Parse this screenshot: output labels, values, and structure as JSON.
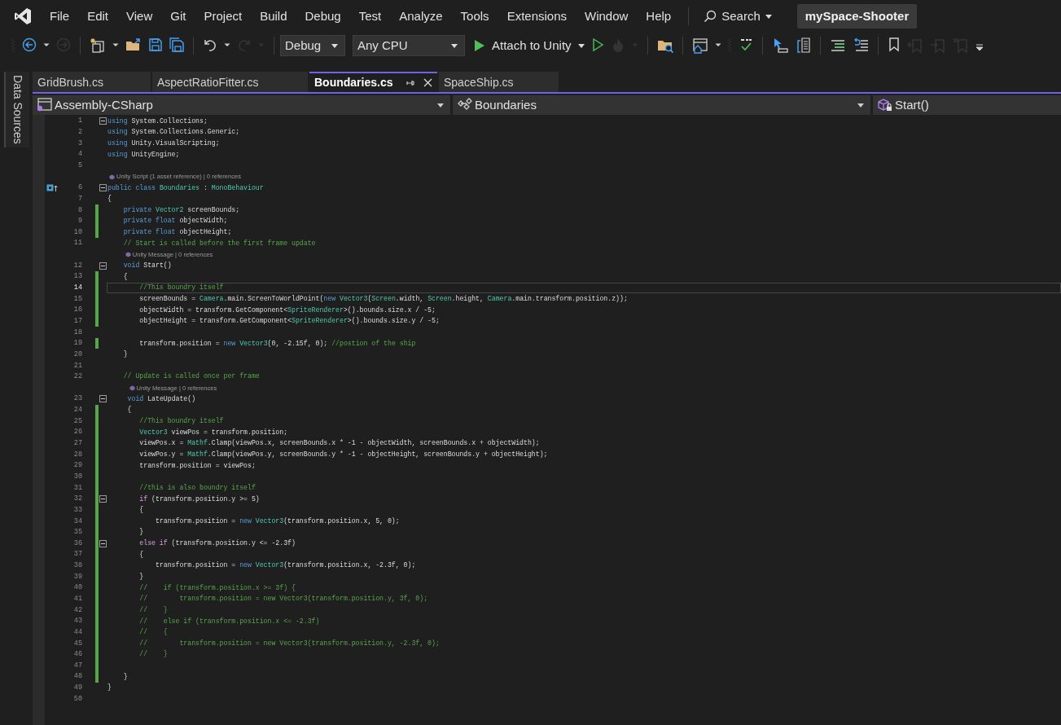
{
  "menu": [
    "File",
    "Edit",
    "View",
    "Git",
    "Project",
    "Build",
    "Debug",
    "Test",
    "Analyze",
    "Tools",
    "Extensions",
    "Window",
    "Help"
  ],
  "search": {
    "label": "Search"
  },
  "solution_name": "mySpace-Shooter",
  "toolbar": [
    {
      "kind": "grip"
    },
    {
      "kind": "back",
      "disabled": false
    },
    {
      "kind": "caret",
      "disabled": false
    },
    {
      "kind": "forward",
      "disabled": true
    },
    {
      "kind": "separator"
    },
    {
      "kind": "new-item",
      "disabled": false
    },
    {
      "kind": "caret",
      "disabled": false
    },
    {
      "kind": "open",
      "disabled": false
    },
    {
      "kind": "save",
      "disabled": false
    },
    {
      "kind": "save-all",
      "disabled": false
    },
    {
      "kind": "separator"
    },
    {
      "kind": "undo",
      "disabled": false
    },
    {
      "kind": "caret",
      "disabled": false
    },
    {
      "kind": "redo",
      "disabled": true
    },
    {
      "kind": "caret",
      "disabled": true
    },
    {
      "kind": "separator"
    },
    {
      "kind": "select",
      "label": "Debug"
    },
    {
      "kind": "select",
      "label": "Any CPU"
    },
    {
      "kind": "run",
      "label": "Attach to Unity"
    },
    {
      "kind": "play-outline",
      "disabled": false
    },
    {
      "kind": "flame",
      "disabled": true
    },
    {
      "kind": "caret",
      "disabled": true
    },
    {
      "kind": "separator"
    },
    {
      "kind": "folder-search",
      "disabled": false
    },
    {
      "kind": "separator"
    },
    {
      "kind": "window-home",
      "disabled": false
    },
    {
      "kind": "caret",
      "disabled": false
    },
    {
      "kind": "grip"
    },
    {
      "kind": "spell-check",
      "disabled": false
    },
    {
      "kind": "separator"
    },
    {
      "kind": "pointer",
      "disabled": false
    },
    {
      "kind": "bracket-list",
      "disabled": false
    },
    {
      "kind": "separator"
    },
    {
      "kind": "indent",
      "disabled": false
    },
    {
      "kind": "outdent",
      "disabled": false
    },
    {
      "kind": "separator"
    },
    {
      "kind": "bookmark",
      "disabled": false
    },
    {
      "kind": "bookmark-prev",
      "disabled": true
    },
    {
      "kind": "bookmark-next",
      "disabled": true
    },
    {
      "kind": "bookmark-clear",
      "disabled": true
    },
    {
      "kind": "overflow",
      "disabled": false
    }
  ],
  "side_panel": {
    "label": "Data Sources"
  },
  "tabs": [
    {
      "label": "GridBrush.cs",
      "selected": false
    },
    {
      "label": "AspectRatioFitter.cs",
      "selected": false
    },
    {
      "label": "Boundaries.cs",
      "selected": true
    },
    {
      "label": "SpaceShip.cs",
      "selected": false
    }
  ],
  "navigation": {
    "project": "Assembly-CSharp",
    "type": "Boundaries",
    "member": "Start()"
  },
  "lines": [
    {
      "number": "1",
      "changed": false,
      "foldable": true,
      "current": false,
      "tokens": [
        {
          "kind": "kw",
          "text": "using"
        },
        {
          "kind": "plain",
          "text": " System.Collections;"
        }
      ]
    },
    {
      "number": "2",
      "changed": false,
      "foldable": false,
      "current": false,
      "tokens": [
        {
          "kind": "kw",
          "text": "using"
        },
        {
          "kind": "plain",
          "text": " System.Collections.Generic;"
        }
      ]
    },
    {
      "number": "3",
      "changed": false,
      "foldable": false,
      "current": false,
      "tokens": [
        {
          "kind": "kw",
          "text": "using"
        },
        {
          "kind": "plain",
          "text": " Unity.VisualScripting;"
        }
      ]
    },
    {
      "number": "4",
      "changed": false,
      "foldable": false,
      "current": false,
      "tokens": [
        {
          "kind": "kw",
          "text": "using"
        },
        {
          "kind": "plain",
          "text": " UnityEngine;"
        }
      ]
    },
    {
      "number": "5",
      "changed": false,
      "foldable": false,
      "current": false
    },
    {
      "number": "6",
      "changed": false,
      "foldable": true,
      "current": false,
      "margin_glyph": true,
      "codelens": "Unity Script (1 asset reference) | 0 references",
      "tokens": [
        {
          "kind": "kw",
          "text": "public class "
        },
        {
          "kind": "type",
          "text": "Boundaries"
        },
        {
          "kind": "plain",
          "text": " : "
        },
        {
          "kind": "type",
          "text": "MonoBehaviour"
        }
      ]
    },
    {
      "number": "7",
      "changed": false,
      "foldable": false,
      "current": false,
      "tokens": [
        {
          "kind": "plain",
          "text": "{"
        }
      ]
    },
    {
      "number": "8",
      "changed": true,
      "foldable": false,
      "current": false,
      "tokens": [
        {
          "kind": "kw",
          "text": "    private "
        },
        {
          "kind": "type",
          "text": "Vector2"
        },
        {
          "kind": "plain",
          "text": " screenBounds;"
        }
      ]
    },
    {
      "number": "9",
      "changed": true,
      "foldable": false,
      "current": false,
      "tokens": [
        {
          "kind": "kw",
          "text": "    private float"
        },
        {
          "kind": "plain",
          "text": " objectWidth;"
        }
      ]
    },
    {
      "number": "10",
      "changed": true,
      "foldable": false,
      "current": false,
      "tokens": [
        {
          "kind": "kw",
          "text": "    private float"
        },
        {
          "kind": "plain",
          "text": " objectHeight;"
        }
      ]
    },
    {
      "number": "11",
      "changed": false,
      "foldable": false,
      "current": false,
      "tokens": [
        {
          "kind": "comment",
          "text": "    // Start is called before the first frame update"
        }
      ]
    },
    {
      "number": "12",
      "changed": false,
      "foldable": true,
      "current": false,
      "codelens": "Unity Message | 0 references",
      "tokens": [
        {
          "kind": "kw",
          "text": "    void"
        },
        {
          "kind": "plain",
          "text": " Start()"
        }
      ]
    },
    {
      "number": "13",
      "changed": true,
      "foldable": false,
      "current": false,
      "tokens": [
        {
          "kind": "plain",
          "text": "    {"
        }
      ]
    },
    {
      "number": "14",
      "changed": true,
      "foldable": false,
      "current": true,
      "tokens": [
        {
          "kind": "comment",
          "text": "        //This boundry itself"
        }
      ]
    },
    {
      "number": "15",
      "changed": true,
      "foldable": false,
      "current": false,
      "tokens": [
        {
          "kind": "plain",
          "text": "        screenBounds = "
        },
        {
          "kind": "type",
          "text": "Camera"
        },
        {
          "kind": "plain",
          "text": ".main.ScreenToWorldPoint("
        },
        {
          "kind": "kw",
          "text": "new "
        },
        {
          "kind": "type",
          "text": "Vector3"
        },
        {
          "kind": "plain",
          "text": "("
        },
        {
          "kind": "type",
          "text": "Screen"
        },
        {
          "kind": "plain",
          "text": ".width, "
        },
        {
          "kind": "type",
          "text": "Screen"
        },
        {
          "kind": "plain",
          "text": ".height, "
        },
        {
          "kind": "type",
          "text": "Camera"
        },
        {
          "kind": "plain",
          "text": ".main.transform.position.z));"
        }
      ]
    },
    {
      "number": "16",
      "changed": true,
      "foldable": false,
      "current": false,
      "tokens": [
        {
          "kind": "plain",
          "text": "        objectWidth = transform.GetComponent<"
        },
        {
          "kind": "type",
          "text": "SpriteRenderer"
        },
        {
          "kind": "plain",
          "text": ">().bounds.size.x / -5;"
        }
      ]
    },
    {
      "number": "17",
      "changed": true,
      "foldable": false,
      "current": false,
      "tokens": [
        {
          "kind": "plain",
          "text": "        objectHeight = transform.GetComponent<"
        },
        {
          "kind": "type",
          "text": "SpriteRenderer"
        },
        {
          "kind": "plain",
          "text": ">().bounds.size.y / -5;"
        }
      ]
    },
    {
      "number": "18",
      "changed": false,
      "foldable": false,
      "current": false
    },
    {
      "number": "19",
      "changed": true,
      "foldable": false,
      "current": false,
      "tokens": [
        {
          "kind": "plain",
          "text": "        transform.position = "
        },
        {
          "kind": "kw",
          "text": "new "
        },
        {
          "kind": "type",
          "text": "Vector3"
        },
        {
          "kind": "plain",
          "text": "(0, -2.15f, 0); "
        },
        {
          "kind": "comment",
          "text": "//postion of the ship"
        }
      ]
    },
    {
      "number": "20",
      "changed": false,
      "foldable": false,
      "current": false,
      "tokens": [
        {
          "kind": "plain",
          "text": "    }"
        }
      ]
    },
    {
      "number": "21",
      "changed": false,
      "foldable": false,
      "current": false
    },
    {
      "number": "22",
      "changed": false,
      "foldable": false,
      "current": false,
      "tokens": [
        {
          "kind": "comment",
          "text": "    // Update is called once per frame"
        }
      ]
    },
    {
      "number": "23",
      "changed": false,
      "foldable": true,
      "current": false,
      "codelens": "Unity Message | 0 references",
      "tokens": [
        {
          "kind": "kw",
          "text": "     void"
        },
        {
          "kind": "plain",
          "text": " LateUpdate()"
        }
      ]
    },
    {
      "number": "24",
      "changed": true,
      "foldable": false,
      "current": false,
      "tokens": [
        {
          "kind": "plain",
          "text": "     {"
        }
      ]
    },
    {
      "number": "25",
      "changed": true,
      "foldable": false,
      "current": false,
      "tokens": [
        {
          "kind": "comment",
          "text": "        //This boundry itself"
        }
      ]
    },
    {
      "number": "26",
      "changed": true,
      "foldable": false,
      "current": false,
      "tokens": [
        {
          "kind": "type",
          "text": "        Vector3"
        },
        {
          "kind": "plain",
          "text": " viewPos = transform.position;"
        }
      ]
    },
    {
      "number": "27",
      "changed": true,
      "foldable": false,
      "current": false,
      "tokens": [
        {
          "kind": "plain",
          "text": "        viewPos.x = "
        },
        {
          "kind": "type",
          "text": "Mathf"
        },
        {
          "kind": "plain",
          "text": ".Clamp(viewPos.x, screenBounds.x * -1 - objectWidth, screenBounds.x + objectWidth);"
        }
      ]
    },
    {
      "number": "28",
      "changed": true,
      "foldable": false,
      "current": false,
      "tokens": [
        {
          "kind": "plain",
          "text": "        viewPos.y = "
        },
        {
          "kind": "type",
          "text": "Mathf"
        },
        {
          "kind": "plain",
          "text": ".Clamp(viewPos.y, screenBounds.y * -1 - objectHeight, screenBounds.y + objectHeight);"
        }
      ]
    },
    {
      "number": "29",
      "changed": true,
      "foldable": false,
      "current": false,
      "tokens": [
        {
          "kind": "plain",
          "text": "        transform.position = viewPos;"
        }
      ]
    },
    {
      "number": "30",
      "changed": true,
      "foldable": false,
      "current": false
    },
    {
      "number": "31",
      "changed": true,
      "foldable": false,
      "current": false,
      "tokens": [
        {
          "kind": "comment",
          "text": "        //this is also boundry itself"
        }
      ]
    },
    {
      "number": "32",
      "changed": true,
      "foldable": true,
      "current": false,
      "tokens": [
        {
          "kind": "control",
          "text": "        if"
        },
        {
          "kind": "plain",
          "text": " (transform.position.y >= 5)"
        }
      ]
    },
    {
      "number": "33",
      "changed": true,
      "foldable": false,
      "current": false,
      "tokens": [
        {
          "kind": "plain",
          "text": "        {"
        }
      ]
    },
    {
      "number": "34",
      "changed": true,
      "foldable": false,
      "current": false,
      "tokens": [
        {
          "kind": "plain",
          "text": "            transform.position = "
        },
        {
          "kind": "kw",
          "text": "new "
        },
        {
          "kind": "type",
          "text": "Vector3"
        },
        {
          "kind": "plain",
          "text": "(transform.position.x, 5, 0);"
        }
      ]
    },
    {
      "number": "35",
      "changed": true,
      "foldable": false,
      "current": false,
      "tokens": [
        {
          "kind": "plain",
          "text": "        }"
        }
      ]
    },
    {
      "number": "36",
      "changed": true,
      "foldable": true,
      "current": false,
      "tokens": [
        {
          "kind": "control",
          "text": "        else if"
        },
        {
          "kind": "plain",
          "text": " (transform.position.y <= -2.3f)"
        }
      ]
    },
    {
      "number": "37",
      "changed": true,
      "foldable": false,
      "current": false,
      "tokens": [
        {
          "kind": "plain",
          "text": "        {"
        }
      ]
    },
    {
      "number": "38",
      "changed": true,
      "foldable": false,
      "current": false,
      "tokens": [
        {
          "kind": "plain",
          "text": "            transform.position = "
        },
        {
          "kind": "kw",
          "text": "new "
        },
        {
          "kind": "type",
          "text": "Vector3"
        },
        {
          "kind": "plain",
          "text": "(transform.position.x, -2.3f, 0);"
        }
      ]
    },
    {
      "number": "39",
      "changed": true,
      "foldable": false,
      "current": false,
      "tokens": [
        {
          "kind": "plain",
          "text": "        }"
        }
      ]
    },
    {
      "number": "40",
      "changed": true,
      "foldable": false,
      "current": false,
      "tokens": [
        {
          "kind": "comment",
          "text": "        //    if (transform.position.x >= 3f) {"
        }
      ]
    },
    {
      "number": "41",
      "changed": true,
      "foldable": false,
      "current": false,
      "tokens": [
        {
          "kind": "comment",
          "text": "        //        transform.position = new Vector3(transform.position.y, 3f, 0);"
        }
      ]
    },
    {
      "number": "42",
      "changed": true,
      "foldable": false,
      "current": false,
      "tokens": [
        {
          "kind": "comment",
          "text": "        //    }"
        }
      ]
    },
    {
      "number": "43",
      "changed": true,
      "foldable": false,
      "current": false,
      "tokens": [
        {
          "kind": "comment",
          "text": "        //    else if (transform.position.x <= -2.3f)"
        }
      ]
    },
    {
      "number": "44",
      "changed": true,
      "foldable": false,
      "current": false,
      "tokens": [
        {
          "kind": "comment",
          "text": "        //    {"
        }
      ]
    },
    {
      "number": "45",
      "changed": true,
      "foldable": false,
      "current": false,
      "tokens": [
        {
          "kind": "comment",
          "text": "        //        transform.position = new Vector3(transform.position.y, -2.3f, 0);"
        }
      ]
    },
    {
      "number": "46",
      "changed": true,
      "foldable": false,
      "current": false,
      "tokens": [
        {
          "kind": "comment",
          "text": "        //    }"
        }
      ]
    },
    {
      "number": "47",
      "changed": true,
      "foldable": false,
      "current": false
    },
    {
      "number": "48",
      "changed": true,
      "foldable": false,
      "current": false,
      "tokens": [
        {
          "kind": "plain",
          "text": "    }"
        }
      ]
    },
    {
      "number": "49",
      "changed": false,
      "foldable": false,
      "current": false,
      "tokens": [
        {
          "kind": "plain",
          "text": "}"
        }
      ]
    },
    {
      "number": "50",
      "changed": false,
      "foldable": false,
      "current": false
    }
  ]
}
